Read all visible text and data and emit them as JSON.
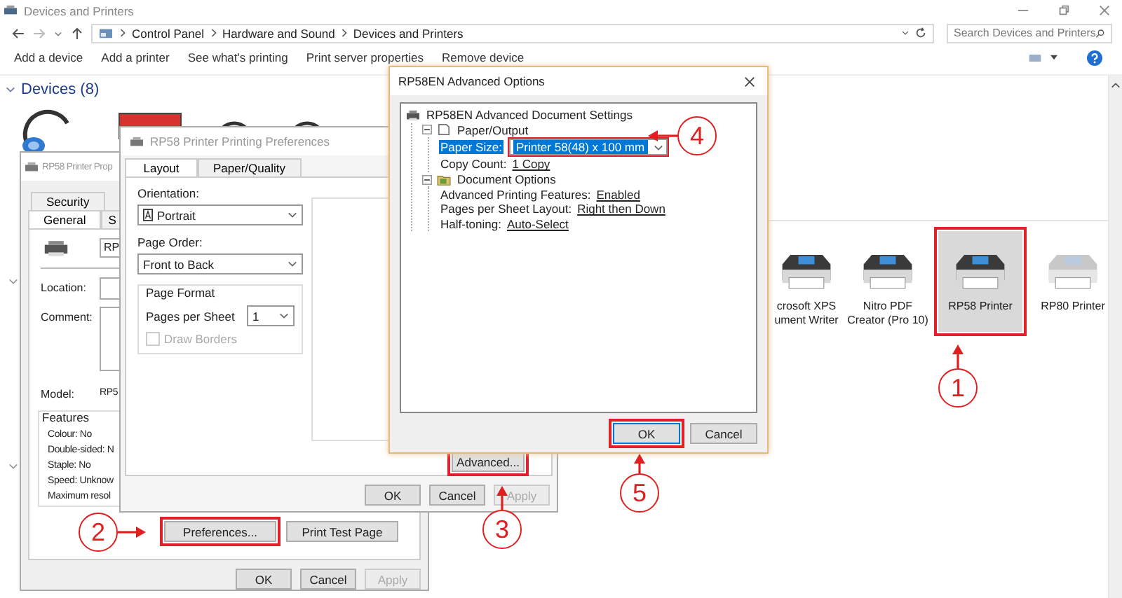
{
  "window": {
    "title": "Devices and Printers"
  },
  "address_bar": {
    "path": [
      "Control Panel",
      "Hardware and Sound",
      "Devices and Printers"
    ]
  },
  "search": {
    "placeholder": "Search Devices and Printers"
  },
  "toolbar": [
    {
      "label": "Add a device"
    },
    {
      "label": "Add a printer"
    },
    {
      "label": "See what's printing"
    },
    {
      "label": "Print server properties"
    },
    {
      "label": "Remove device"
    }
  ],
  "section": {
    "title": "Devices (8)",
    "expanded": true
  },
  "printers": [
    {
      "label": "crosoft XPS\nument Writer",
      "selected": false,
      "highlighted": false,
      "offline": false
    },
    {
      "label": "Nitro PDF\nCreator (Pro 10)",
      "selected": false,
      "highlighted": false,
      "offline": false
    },
    {
      "label": "RP58 Printer",
      "selected": true,
      "highlighted": true,
      "offline": false
    },
    {
      "label": "RP80 Printer",
      "selected": false,
      "highlighted": false,
      "offline": true
    }
  ],
  "properties_dialog": {
    "title": "RP58 Printer Prop",
    "tab_rows": [
      {
        "tabs": [
          {
            "label": "Security",
            "selected": false
          }
        ]
      },
      {
        "tabs": [
          {
            "label": "General",
            "selected": true
          },
          {
            "label": "S",
            "selected": false
          }
        ]
      }
    ],
    "printer_name": "RP",
    "fields": [
      {
        "label": "Location:",
        "multiline": false
      },
      {
        "label": "Comment:",
        "multiline": true
      }
    ],
    "model": {
      "label": "Model:",
      "value": "RP5"
    },
    "features": {
      "title": "Features",
      "items": [
        "Colour: No",
        "Double-sided: N",
        "Staple: No",
        "Speed: Unknow",
        "Maximum resol"
      ]
    },
    "buttons": [
      {
        "label": "Preferences...",
        "highlighted": true
      },
      {
        "label": "Print Test Page",
        "highlighted": false
      }
    ],
    "footer_buttons": [
      {
        "label": "OK",
        "disabled": false
      },
      {
        "label": "Cancel",
        "disabled": false
      },
      {
        "label": "Apply",
        "disabled": true
      }
    ]
  },
  "preferences_dialog": {
    "title": "RP58 Printer Printing Preferences",
    "tabs": [
      {
        "label": "Layout",
        "selected": true
      },
      {
        "label": "Paper/Quality",
        "selected": false
      }
    ],
    "orientation": {
      "label": "Orientation:",
      "value": "Portrait"
    },
    "page_order": {
      "label": "Page Order:",
      "value": "Front to Back"
    },
    "page_format": {
      "title": "Page Format",
      "pages_per_sheet": {
        "label": "Pages per Sheet",
        "value": "1"
      },
      "draw_borders": {
        "label": "Draw Borders",
        "checked": false,
        "disabled": true
      }
    },
    "advanced_button": {
      "label": "Advanced...",
      "highlighted": true
    },
    "buttons": [
      {
        "label": "OK",
        "disabled": false
      },
      {
        "label": "Cancel",
        "disabled": false
      },
      {
        "label": "Apply",
        "disabled": true
      }
    ]
  },
  "advanced_dialog": {
    "title": "RP58EN Advanced Options",
    "tree": [
      {
        "label": "RP58EN Advanced Document Settings",
        "kind": "printer",
        "children": [
          {
            "label": "Paper/Output",
            "kind": "paper",
            "expanded": true,
            "children": [
              {
                "label": "Paper Size:",
                "kind": "dropdown",
                "value": "Printer 58(48) x 100 mm",
                "selected": true,
                "highlighted": true
              },
              {
                "label": "Copy Count:",
                "kind": "link",
                "value": "1 Copy",
                "selected": false,
                "highlighted": false
              }
            ]
          },
          {
            "label": "Document Options",
            "kind": "folder",
            "expanded": true,
            "children": [
              {
                "label": "Advanced Printing Features:",
                "kind": "link",
                "value": "Enabled",
                "selected": false,
                "highlighted": false
              },
              {
                "label": "Pages per Sheet Layout:",
                "kind": "link",
                "value": "Right then Down",
                "selected": false,
                "highlighted": false
              },
              {
                "label": "Half-toning:",
                "kind": "link",
                "value": "Auto-Select",
                "selected": false,
                "highlighted": false
              }
            ]
          }
        ]
      }
    ],
    "buttons": [
      {
        "label": "OK",
        "default": true,
        "highlighted": true
      },
      {
        "label": "Cancel",
        "default": false,
        "highlighted": false
      }
    ]
  },
  "callouts": [
    {
      "number": "1"
    },
    {
      "number": "2"
    },
    {
      "number": "3"
    },
    {
      "number": "4"
    },
    {
      "number": "5"
    }
  ]
}
